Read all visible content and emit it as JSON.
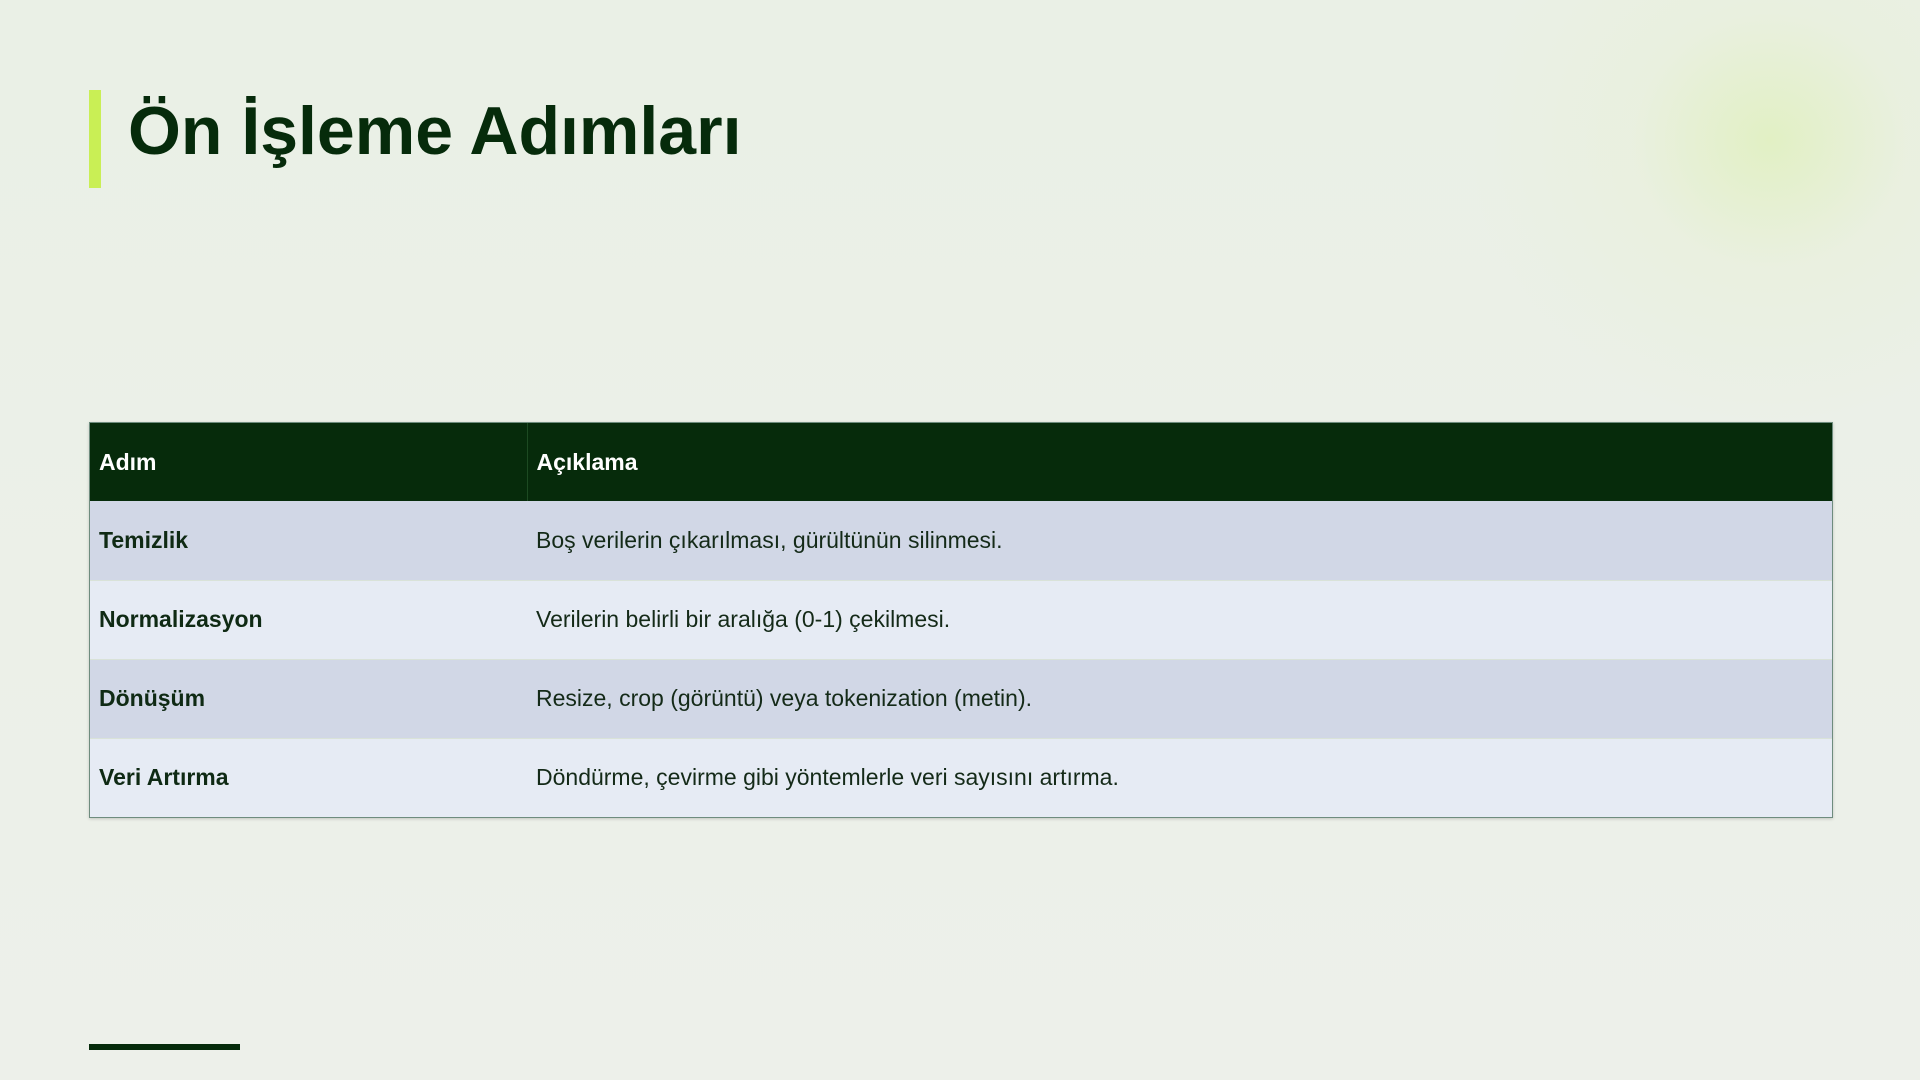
{
  "slide": {
    "title": "Ön İşleme Adımları"
  },
  "table": {
    "headers": [
      "Adım",
      "Açıklama"
    ],
    "rows": [
      {
        "step": "Temizlik",
        "description": "Boş verilerin çıkarılması, gürültünün silinmesi."
      },
      {
        "step": "Normalizasyon",
        "description": "Verilerin belirli bir aralığa (0-1) çekilmesi."
      },
      {
        "step": "Dönüşüm",
        "description": "Resize, crop (görüntü) veya tokenization (metin)."
      },
      {
        "step": "Veri Artırma",
        "description": "Döndürme, çevirme gibi yöntemlerle veri sayısını artırma."
      }
    ]
  },
  "colors": {
    "accent": "#c9ef55",
    "dark_green": "#062b0b",
    "row_odd": "#d1d7e6",
    "row_even": "#e6ebf4"
  }
}
